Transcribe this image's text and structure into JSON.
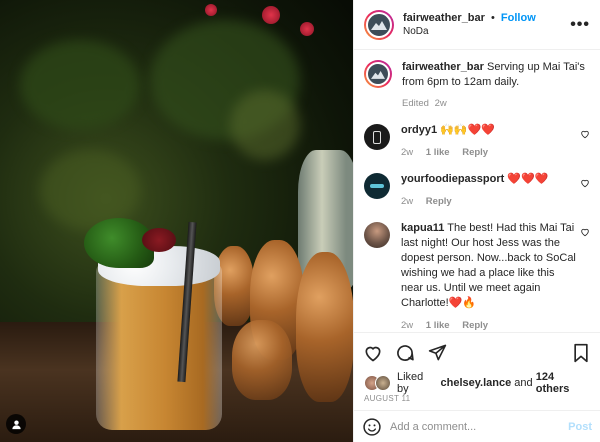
{
  "header": {
    "username": "fairweather_bar",
    "dot": "•",
    "follow_label": "Follow",
    "location": "NoDa",
    "more_label": "•••"
  },
  "caption": {
    "username": "fairweather_bar",
    "text": "Serving up Mai Tai's from 6pm to 12am daily.",
    "edited": "Edited",
    "age": "2w"
  },
  "comments": [
    {
      "username": "ordyy1",
      "text": "🙌🙌❤️❤️",
      "age": "2w",
      "likes": "1 like",
      "reply": "Reply",
      "avatar_color": "#1a1a1a"
    },
    {
      "username": "yourfoodiepassport",
      "text": "❤️❤️❤️",
      "age": "2w",
      "likes": "",
      "reply": "Reply",
      "avatar_color": "#0f2a33"
    },
    {
      "username": "kapua11",
      "text": "The best! Had this Mai Tai last night! Our host Jess was the dopest person. Now...back to SoCal wishing we had a place like this near us. Until we meet again Charlotte!❤️🔥",
      "age": "2w",
      "likes": "1 like",
      "reply": "Reply",
      "avatar_color": "#7a6a60"
    }
  ],
  "actions": {
    "like_icon": "heart-icon",
    "comment_icon": "comment-icon",
    "share_icon": "paper-plane-icon",
    "save_icon": "bookmark-icon"
  },
  "likes": {
    "prefix": "Liked by",
    "user": "chelsey.lance",
    "and": "and",
    "others": "124 others"
  },
  "date": "AUGUST 11",
  "add_comment": {
    "placeholder": "Add a comment...",
    "post_label": "Post"
  },
  "colors": {
    "accent": "#0095f6",
    "muted": "#8e8e8e",
    "post_disabled": "#b2dffc"
  }
}
